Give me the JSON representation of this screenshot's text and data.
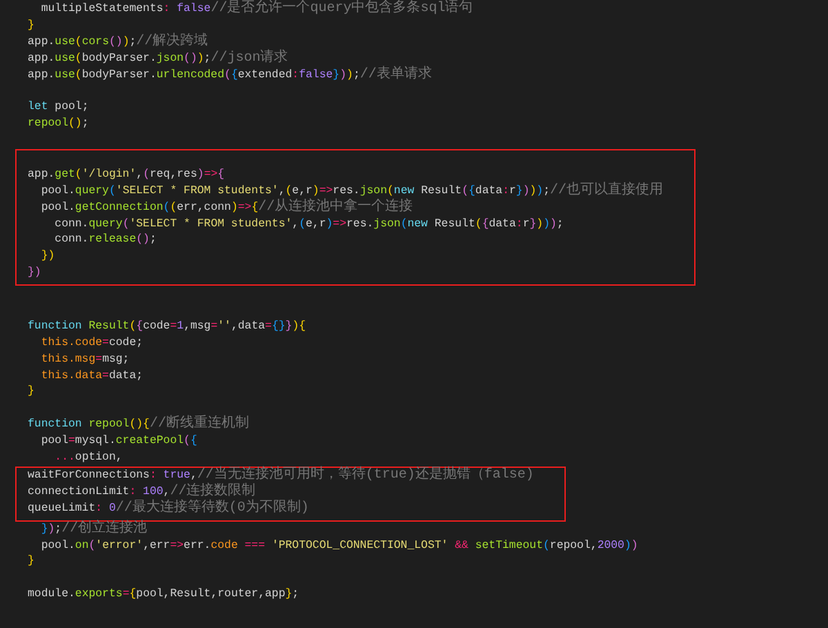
{
  "editor": {
    "blocks": [
      {
        "highlighted": false,
        "lines": [
          {
            "kind": "code",
            "tokens": [
              {
                "kind": "plain",
                "text": "  multipleStatements"
              },
              {
                "kind": "operator",
                "text": ": "
              },
              {
                "kind": "literal",
                "text": "false"
              },
              {
                "kind": "comment",
                "text": "//是否允许一个query中包含多条sql语句"
              }
            ]
          },
          {
            "kind": "code",
            "tokens": [
              {
                "kind": "bracket1",
                "text": "}"
              }
            ]
          },
          {
            "kind": "code",
            "tokens": [
              {
                "kind": "plain",
                "text": "app."
              },
              {
                "kind": "function",
                "text": "use"
              },
              {
                "kind": "bracket1",
                "text": "("
              },
              {
                "kind": "function",
                "text": "cors"
              },
              {
                "kind": "bracket2",
                "text": "()"
              },
              {
                "kind": "bracket1",
                "text": ")"
              },
              {
                "kind": "plain",
                "text": ";"
              },
              {
                "kind": "comment",
                "text": "//解决跨域"
              }
            ]
          },
          {
            "kind": "code",
            "tokens": [
              {
                "kind": "plain",
                "text": "app."
              },
              {
                "kind": "function",
                "text": "use"
              },
              {
                "kind": "bracket1",
                "text": "("
              },
              {
                "kind": "plain",
                "text": "bodyParser."
              },
              {
                "kind": "function",
                "text": "json"
              },
              {
                "kind": "bracket2",
                "text": "()"
              },
              {
                "kind": "bracket1",
                "text": ")"
              },
              {
                "kind": "plain",
                "text": ";"
              },
              {
                "kind": "comment",
                "text": "//json请求"
              }
            ]
          },
          {
            "kind": "code",
            "tokens": [
              {
                "kind": "plain",
                "text": "app."
              },
              {
                "kind": "function",
                "text": "use"
              },
              {
                "kind": "bracket1",
                "text": "("
              },
              {
                "kind": "plain",
                "text": "bodyParser."
              },
              {
                "kind": "function",
                "text": "urlencoded"
              },
              {
                "kind": "bracket2",
                "text": "("
              },
              {
                "kind": "bracket3",
                "text": "{"
              },
              {
                "kind": "plain",
                "text": "extended"
              },
              {
                "kind": "operator",
                "text": ":"
              },
              {
                "kind": "literal",
                "text": "false"
              },
              {
                "kind": "bracket3",
                "text": "}"
              },
              {
                "kind": "bracket2",
                "text": ")"
              },
              {
                "kind": "bracket1",
                "text": ")"
              },
              {
                "kind": "plain",
                "text": ";"
              },
              {
                "kind": "comment",
                "text": "//表单请求"
              }
            ]
          },
          {
            "kind": "blank"
          },
          {
            "kind": "code",
            "tokens": [
              {
                "kind": "keyword",
                "text": "let"
              },
              {
                "kind": "plain",
                "text": " pool;"
              }
            ]
          },
          {
            "kind": "code",
            "tokens": [
              {
                "kind": "function",
                "text": "repool"
              },
              {
                "kind": "bracket1",
                "text": "()"
              },
              {
                "kind": "plain",
                "text": ";"
              }
            ]
          },
          {
            "kind": "blank"
          }
        ]
      },
      {
        "highlighted": true,
        "lines": [
          {
            "kind": "blank"
          },
          {
            "kind": "code",
            "tokens": [
              {
                "kind": "plain",
                "text": "app."
              },
              {
                "kind": "function",
                "text": "get"
              },
              {
                "kind": "bracket1",
                "text": "("
              },
              {
                "kind": "string",
                "text": "'/login'"
              },
              {
                "kind": "plain",
                "text": ","
              },
              {
                "kind": "bracket2",
                "text": "("
              },
              {
                "kind": "plain",
                "text": "req,res"
              },
              {
                "kind": "bracket2",
                "text": ")"
              },
              {
                "kind": "operator",
                "text": "=>"
              },
              {
                "kind": "bracket2",
                "text": "{"
              }
            ]
          },
          {
            "kind": "code",
            "tokens": [
              {
                "kind": "plain",
                "text": "  pool."
              },
              {
                "kind": "function",
                "text": "query"
              },
              {
                "kind": "bracket3",
                "text": "("
              },
              {
                "kind": "string",
                "text": "'SELECT * FROM students'"
              },
              {
                "kind": "plain",
                "text": ","
              },
              {
                "kind": "bracket1",
                "text": "("
              },
              {
                "kind": "plain",
                "text": "e,r"
              },
              {
                "kind": "bracket1",
                "text": ")"
              },
              {
                "kind": "operator",
                "text": "=>"
              },
              {
                "kind": "plain",
                "text": "res."
              },
              {
                "kind": "function",
                "text": "json"
              },
              {
                "kind": "bracket1",
                "text": "("
              },
              {
                "kind": "keyword",
                "text": "new"
              },
              {
                "kind": "plain",
                "text": " Result"
              },
              {
                "kind": "bracket2",
                "text": "("
              },
              {
                "kind": "bracket3",
                "text": "{"
              },
              {
                "kind": "plain",
                "text": "data"
              },
              {
                "kind": "operator",
                "text": ":"
              },
              {
                "kind": "plain",
                "text": "r"
              },
              {
                "kind": "bracket3",
                "text": "}"
              },
              {
                "kind": "bracket2",
                "text": ")"
              },
              {
                "kind": "bracket1",
                "text": ")"
              },
              {
                "kind": "bracket3",
                "text": ")"
              },
              {
                "kind": "plain",
                "text": ";"
              },
              {
                "kind": "comment",
                "text": "//也可以直接使用"
              }
            ]
          },
          {
            "kind": "code",
            "tokens": [
              {
                "kind": "plain",
                "text": "  pool."
              },
              {
                "kind": "function",
                "text": "getConnection"
              },
              {
                "kind": "bracket3",
                "text": "("
              },
              {
                "kind": "bracket1",
                "text": "("
              },
              {
                "kind": "plain",
                "text": "err,conn"
              },
              {
                "kind": "bracket1",
                "text": ")"
              },
              {
                "kind": "operator",
                "text": "=>"
              },
              {
                "kind": "bracket1",
                "text": "{"
              },
              {
                "kind": "comment",
                "text": "//从连接池中拿一个连接"
              }
            ]
          },
          {
            "kind": "code",
            "tokens": [
              {
                "kind": "plain",
                "text": "    conn."
              },
              {
                "kind": "function",
                "text": "query"
              },
              {
                "kind": "bracket2",
                "text": "("
              },
              {
                "kind": "string",
                "text": "'SELECT * FROM students'"
              },
              {
                "kind": "plain",
                "text": ","
              },
              {
                "kind": "bracket3",
                "text": "("
              },
              {
                "kind": "plain",
                "text": "e,r"
              },
              {
                "kind": "bracket3",
                "text": ")"
              },
              {
                "kind": "operator",
                "text": "=>"
              },
              {
                "kind": "plain",
                "text": "res."
              },
              {
                "kind": "function",
                "text": "json"
              },
              {
                "kind": "bracket3",
                "text": "("
              },
              {
                "kind": "keyword",
                "text": "new"
              },
              {
                "kind": "plain",
                "text": " Result"
              },
              {
                "kind": "bracket1",
                "text": "("
              },
              {
                "kind": "bracket2",
                "text": "{"
              },
              {
                "kind": "plain",
                "text": "data"
              },
              {
                "kind": "operator",
                "text": ":"
              },
              {
                "kind": "plain",
                "text": "r"
              },
              {
                "kind": "bracket2",
                "text": "}"
              },
              {
                "kind": "bracket1",
                "text": ")"
              },
              {
                "kind": "bracket3",
                "text": ")"
              },
              {
                "kind": "bracket2",
                "text": ")"
              },
              {
                "kind": "plain",
                "text": ";"
              }
            ]
          },
          {
            "kind": "code",
            "tokens": [
              {
                "kind": "plain",
                "text": "    conn."
              },
              {
                "kind": "function",
                "text": "release"
              },
              {
                "kind": "bracket2",
                "text": "()"
              },
              {
                "kind": "plain",
                "text": ";"
              }
            ]
          },
          {
            "kind": "code",
            "tokens": [
              {
                "kind": "bracket1",
                "text": "  })"
              }
            ]
          },
          {
            "kind": "code",
            "tokens": [
              {
                "kind": "bracket2",
                "text": "})"
              }
            ]
          }
        ]
      },
      {
        "highlighted": false,
        "lines": [
          {
            "kind": "blank"
          },
          {
            "kind": "blank"
          },
          {
            "kind": "code",
            "tokens": [
              {
                "kind": "keyword",
                "text": "function"
              },
              {
                "kind": "function",
                "text": " Result"
              },
              {
                "kind": "bracket1",
                "text": "("
              },
              {
                "kind": "bracket2",
                "text": "{"
              },
              {
                "kind": "plain",
                "text": "code"
              },
              {
                "kind": "operator",
                "text": "="
              },
              {
                "kind": "literal",
                "text": "1"
              },
              {
                "kind": "plain",
                "text": ",msg"
              },
              {
                "kind": "operator",
                "text": "="
              },
              {
                "kind": "string",
                "text": "''"
              },
              {
                "kind": "plain",
                "text": ",data"
              },
              {
                "kind": "operator",
                "text": "="
              },
              {
                "kind": "bracket3",
                "text": "{}"
              },
              {
                "kind": "bracket2",
                "text": "}"
              },
              {
                "kind": "bracket1",
                "text": "){"
              }
            ]
          },
          {
            "kind": "code",
            "tokens": [
              {
                "kind": "this",
                "text": "  this.code"
              },
              {
                "kind": "operator",
                "text": "="
              },
              {
                "kind": "plain",
                "text": "code;"
              }
            ]
          },
          {
            "kind": "code",
            "tokens": [
              {
                "kind": "this",
                "text": "  this.msg"
              },
              {
                "kind": "operator",
                "text": "="
              },
              {
                "kind": "plain",
                "text": "msg;"
              }
            ]
          },
          {
            "kind": "code",
            "tokens": [
              {
                "kind": "this",
                "text": "  this.data"
              },
              {
                "kind": "operator",
                "text": "="
              },
              {
                "kind": "plain",
                "text": "data;"
              }
            ]
          },
          {
            "kind": "code",
            "tokens": [
              {
                "kind": "bracket1",
                "text": "}"
              }
            ]
          },
          {
            "kind": "blank"
          },
          {
            "kind": "code",
            "tokens": [
              {
                "kind": "keyword",
                "text": "function"
              },
              {
                "kind": "function",
                "text": " repool"
              },
              {
                "kind": "bracket1",
                "text": "(){"
              },
              {
                "kind": "comment",
                "text": "//断线重连机制"
              }
            ]
          },
          {
            "kind": "code",
            "tokens": [
              {
                "kind": "plain",
                "text": "  pool"
              },
              {
                "kind": "operator",
                "text": "="
              },
              {
                "kind": "plain",
                "text": "mysql."
              },
              {
                "kind": "function",
                "text": "createPool"
              },
              {
                "kind": "bracket2",
                "text": "("
              },
              {
                "kind": "bracket3",
                "text": "{"
              }
            ]
          },
          {
            "kind": "code",
            "tokens": [
              {
                "kind": "operator",
                "text": "    ..."
              },
              {
                "kind": "plain",
                "text": "option,"
              }
            ]
          }
        ]
      },
      {
        "highlighted": true,
        "lines": [
          {
            "kind": "code",
            "tokens": [
              {
                "kind": "plain",
                "text": "waitForConnections"
              },
              {
                "kind": "operator",
                "text": ": "
              },
              {
                "kind": "literal",
                "text": "true"
              },
              {
                "kind": "plain",
                "text": ","
              },
              {
                "kind": "comment",
                "text": "//当无连接池可用时，等待(true)还是抛错（false)"
              }
            ]
          },
          {
            "kind": "code",
            "tokens": [
              {
                "kind": "plain",
                "text": "connectionLimit"
              },
              {
                "kind": "operator",
                "text": ": "
              },
              {
                "kind": "literal",
                "text": "100"
              },
              {
                "kind": "plain",
                "text": ","
              },
              {
                "kind": "comment",
                "text": "//连接数限制"
              }
            ]
          },
          {
            "kind": "code",
            "tokens": [
              {
                "kind": "plain",
                "text": "queueLimit"
              },
              {
                "kind": "operator",
                "text": ": "
              },
              {
                "kind": "literal",
                "text": "0"
              },
              {
                "kind": "comment",
                "text": "//最大连接等待数(0为不限制)"
              }
            ]
          }
        ]
      },
      {
        "highlighted": false,
        "lines": [
          {
            "kind": "code",
            "tokens": [
              {
                "kind": "bracket3",
                "text": "  }"
              },
              {
                "kind": "bracket2",
                "text": ")"
              },
              {
                "kind": "plain",
                "text": ";"
              },
              {
                "kind": "comment",
                "text": "//创立连接池"
              }
            ]
          },
          {
            "kind": "code",
            "tokens": [
              {
                "kind": "plain",
                "text": "  pool."
              },
              {
                "kind": "function",
                "text": "on"
              },
              {
                "kind": "bracket2",
                "text": "("
              },
              {
                "kind": "string",
                "text": "'error'"
              },
              {
                "kind": "plain",
                "text": ",err"
              },
              {
                "kind": "operator",
                "text": "=>"
              },
              {
                "kind": "plain",
                "text": "err."
              },
              {
                "kind": "this",
                "text": "code"
              },
              {
                "kind": "operator",
                "text": " === "
              },
              {
                "kind": "string",
                "text": "'PROTOCOL_CONNECTION_LOST'"
              },
              {
                "kind": "operator",
                "text": " && "
              },
              {
                "kind": "function",
                "text": "setTimeout"
              },
              {
                "kind": "bracket3",
                "text": "("
              },
              {
                "kind": "plain",
                "text": "repool,"
              },
              {
                "kind": "literal",
                "text": "2000"
              },
              {
                "kind": "bracket3",
                "text": ")"
              },
              {
                "kind": "bracket2",
                "text": ")"
              }
            ]
          },
          {
            "kind": "code",
            "tokens": [
              {
                "kind": "bracket1",
                "text": "}"
              }
            ]
          },
          {
            "kind": "blank"
          },
          {
            "kind": "code",
            "tokens": [
              {
                "kind": "plain",
                "text": "module."
              },
              {
                "kind": "function",
                "text": "exports"
              },
              {
                "kind": "operator",
                "text": "="
              },
              {
                "kind": "bracket1",
                "text": "{"
              },
              {
                "kind": "plain",
                "text": "pool,Result,router,app"
              },
              {
                "kind": "bracket1",
                "text": "}"
              },
              {
                "kind": "plain",
                "text": ";"
              }
            ]
          }
        ]
      }
    ]
  }
}
